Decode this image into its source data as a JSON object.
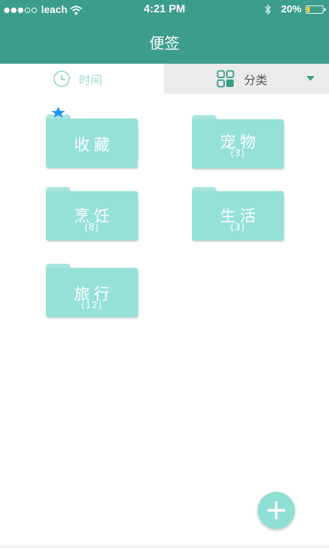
{
  "status_bar": {
    "carrier": "leach",
    "time": "4:21 PM",
    "battery_percent": "20%",
    "battery_level": 0.2
  },
  "header": {
    "title": "便签"
  },
  "tabs": {
    "time_label": "时间",
    "category_label": "分类"
  },
  "folders": [
    {
      "name": "收藏",
      "count": "",
      "favorite": true
    },
    {
      "name": "宠物",
      "count": "(3)"
    },
    {
      "name": "烹饪",
      "count": "(8)"
    },
    {
      "name": "生活",
      "count": "(3)"
    },
    {
      "name": "旅行",
      "count": "(12)"
    }
  ],
  "colors": {
    "header_bg": "#3d9d8b",
    "folder": "#95e1d7",
    "star": "#2196f3",
    "fab": "#8fdfd5"
  },
  "icons": {
    "tab_time": "clock-icon",
    "tab_category": "grid-icon",
    "tab_dropdown": "caret-down-icon",
    "fab": "plus-icon"
  }
}
